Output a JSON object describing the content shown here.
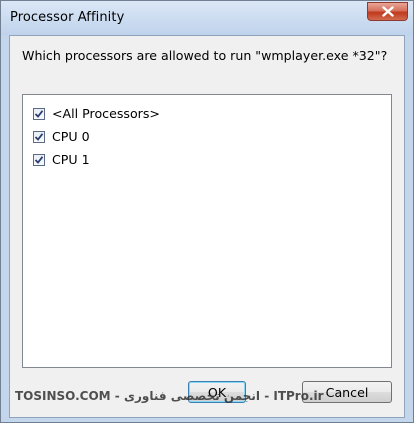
{
  "window": {
    "title": "Processor Affinity",
    "close_glyph": "close-icon"
  },
  "prompt": "Which processors are allowed to run \"wmplayer.exe *32\"?",
  "processors": [
    {
      "label": "<All Processors>",
      "checked": true
    },
    {
      "label": "CPU 0",
      "checked": true
    },
    {
      "label": "CPU 1",
      "checked": true
    }
  ],
  "buttons": {
    "ok_label": "OK",
    "cancel_label": "Cancel"
  },
  "watermark": "TOSINSO.COM - انجمن تخصصی فناوری - ITPro.ir",
  "colors": {
    "titlebar": "#c4d6ec",
    "close_button": "#c0391d",
    "dialog_bg": "#f0f0f0"
  }
}
